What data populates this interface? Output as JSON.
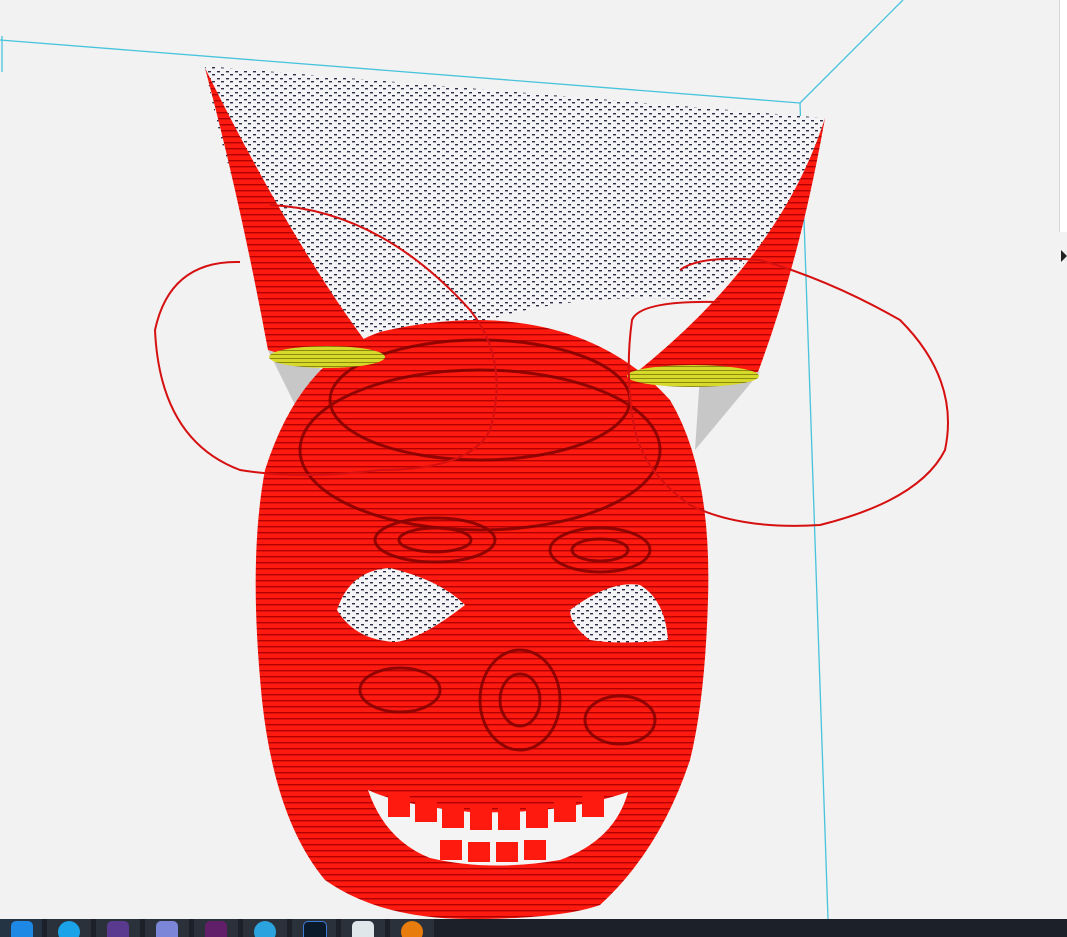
{
  "app": {
    "viewport_name": "3d-slice-preview",
    "background_color": "#f2f2f2",
    "model_color": "#ff1a0f",
    "model_shadow_color": "#8a0000",
    "cut_face_color": "#d6d82a",
    "support_color": "#2b2e44",
    "build_volume_color": "#47c3dc",
    "travel_path_color": "#d61010",
    "overhang_shadow_color": "#c7c7c7"
  },
  "taskbar": {
    "background_color": "#1c2129",
    "items": [
      {
        "icon": "app-icon-c",
        "color": "#1e88e5"
      },
      {
        "icon": "skype-icon",
        "color": "#1aa3e8"
      },
      {
        "icon": "purple-app-icon",
        "color": "#5a3a8f"
      },
      {
        "icon": "discord-icon",
        "color": "#7b86d8"
      },
      {
        "icon": "slack-icon",
        "color": "#611f69"
      },
      {
        "icon": "telegram-icon",
        "color": "#2aa3df"
      },
      {
        "icon": "terminal-icon",
        "color": "#0a1a2a"
      },
      {
        "icon": "notepad-icon",
        "color": "#dfe7ea"
      },
      {
        "icon": "blender-icon",
        "color": "#e87d0d"
      }
    ]
  }
}
